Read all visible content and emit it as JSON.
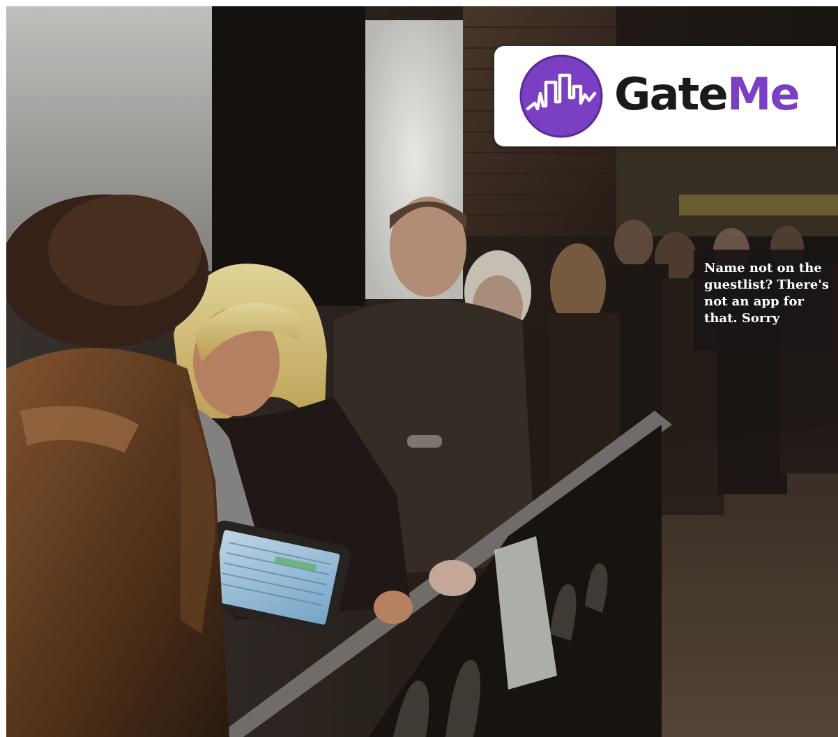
{
  "brand": {
    "name_part1": "Gate",
    "name_part2": "Me",
    "accent_color": "#7b3fc4",
    "dark_color": "#1a1a1a",
    "logo_icon": "soundwave-bars-icon"
  },
  "caption": {
    "text": "Name not on the guestlist? There's not an app for that. Sorry"
  },
  "photo": {
    "subject": "queue-outside-venue-photo"
  }
}
